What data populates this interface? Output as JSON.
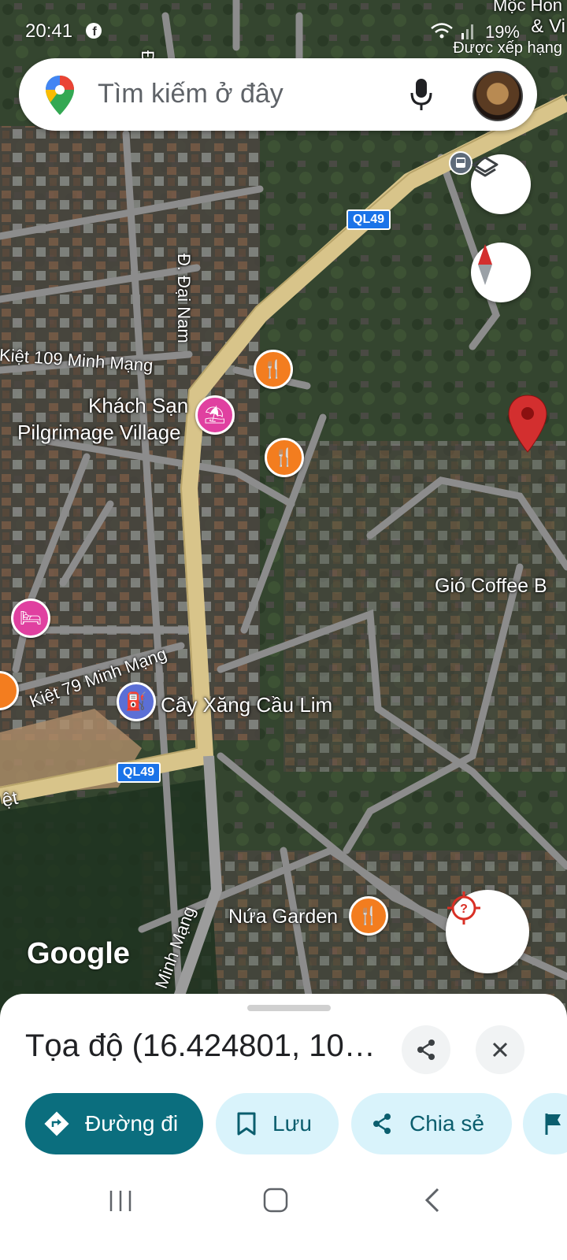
{
  "status": {
    "time": "20:41",
    "battery": "19%"
  },
  "search": {
    "placeholder": "Tìm kiếm ở đây"
  },
  "map_labels": {
    "dai_nam_top": "Đ. Đ",
    "dai_nam": "Đ. Đại Nam",
    "kiet109": "Kiệt 109 Minh Mạng",
    "hotel_line1": "Khách Sạn",
    "hotel_line2": "Pilgrimage Village",
    "gio_coffee": "Gió Coffee B",
    "kiet79": "Kiệt 79 Minh Mạng",
    "gas": "Cây Xăng Cầu Lim",
    "nua_garden": "Nứa Garden",
    "minh_mang": "Minh Mạng",
    "viet_fragment": "ệt",
    "corner_line1": "Mộc Hon",
    "corner_line2": "& Vi",
    "corner_line3": "Được xếp hạng",
    "ql49_a": "QL49",
    "ql49_b": "QL49",
    "google": "Google"
  },
  "sheet": {
    "title": "Tọa độ (16.424801, 10…",
    "actions": {
      "directions": "Đường đi",
      "save": "Lưu",
      "share": "Chia sẻ"
    }
  },
  "colors": {
    "primary": "#0b6e7e",
    "secondary_bg": "#d9f3fb",
    "road_major": "#d8c48a",
    "road_minor": "#8c8c8c",
    "pin_red": "#d32f2f"
  },
  "icons": [
    "facebook-icon",
    "wifi-icon",
    "signal-icon",
    "maps-logo-icon",
    "mic-icon",
    "layers-icon",
    "compass-icon",
    "bus-icon",
    "restaurant-icon",
    "hotel-icon",
    "bed-icon",
    "gas-station-icon",
    "location-pin-icon",
    "my-location-icon",
    "share-icon",
    "close-icon",
    "directions-icon",
    "bookmark-icon",
    "flag-icon",
    "recents-icon",
    "home-icon",
    "back-icon"
  ]
}
